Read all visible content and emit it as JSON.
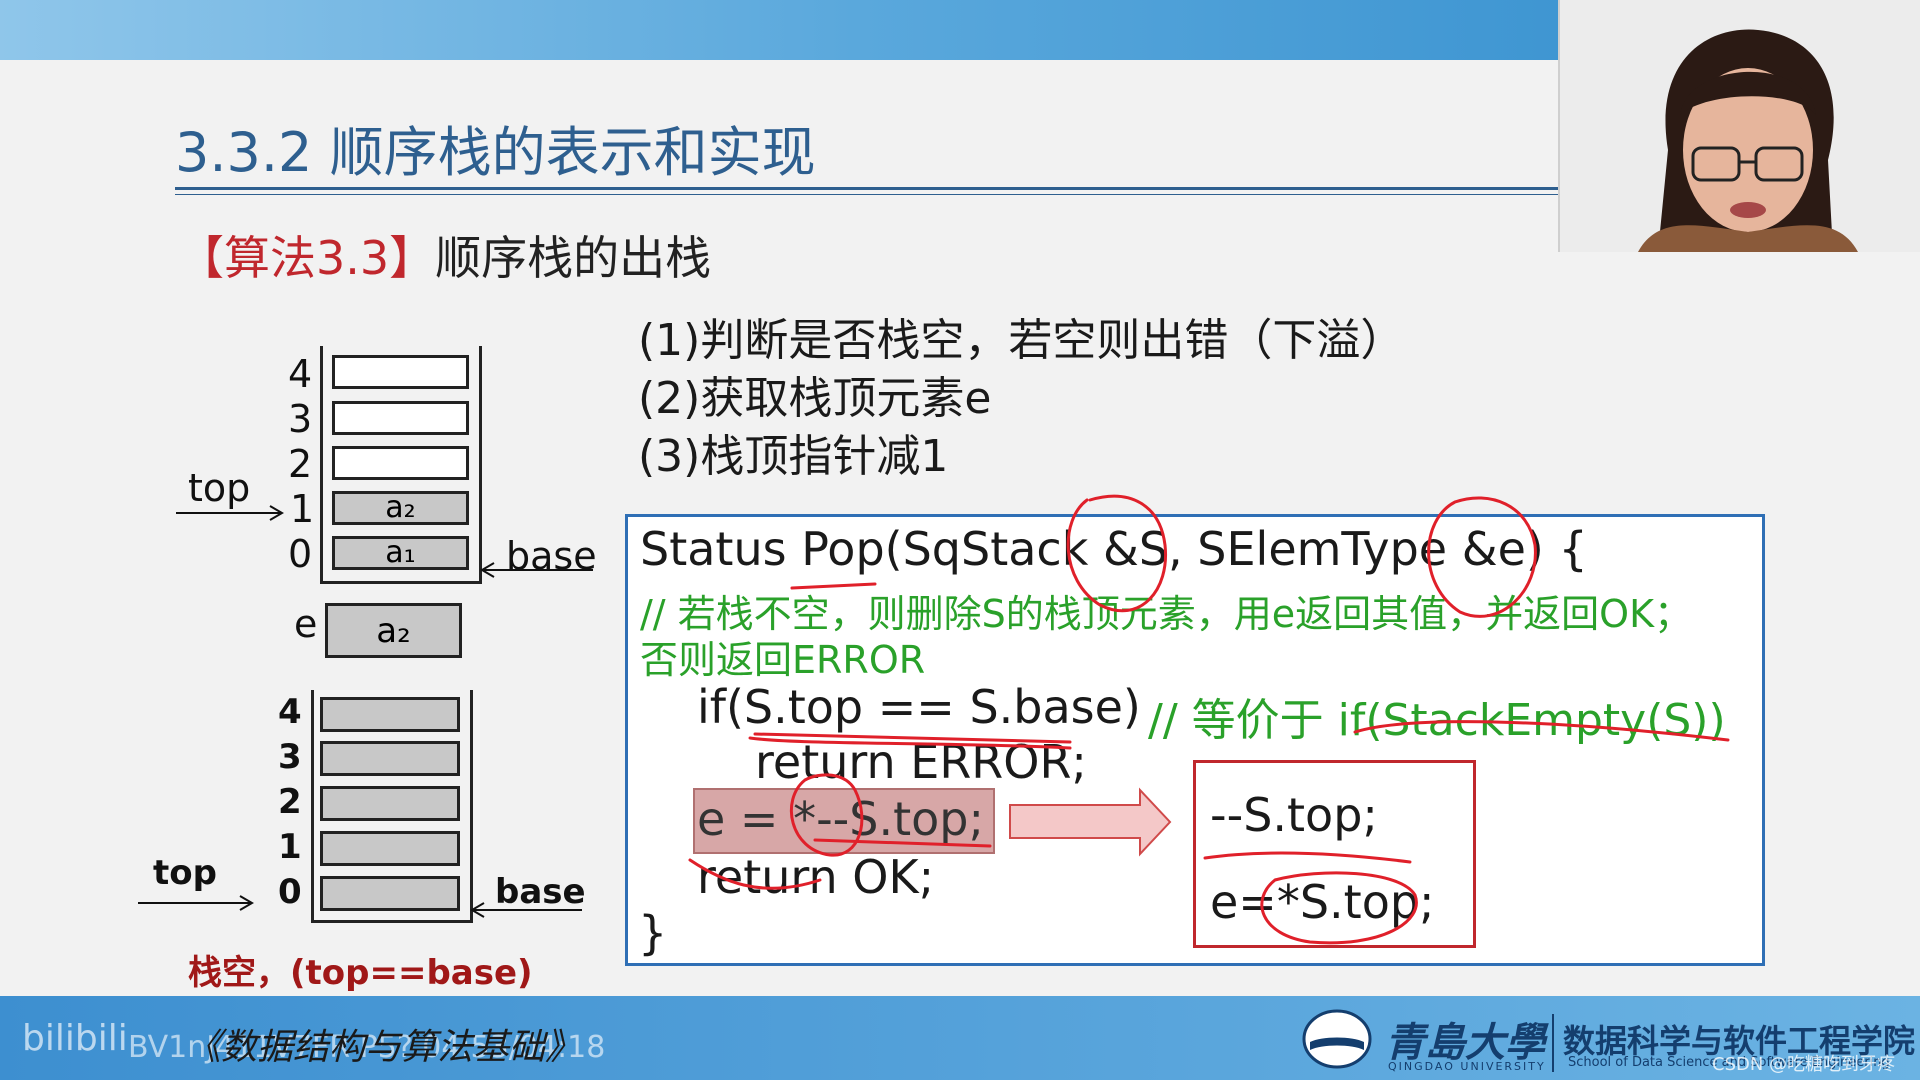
{
  "slide": {
    "title": "3.3.2 顺序栈的表示和实现",
    "algo_tag": "【算法3.3】",
    "algo_name": "顺序栈的出栈",
    "steps": [
      "(1)判断是否栈空，若空则出错（下溢）",
      "(2)获取栈顶元素e",
      "(3)栈顶指针减1"
    ],
    "code": {
      "line1": "Status Pop(SqStack &S, SElemType &e) {",
      "comment1": "// 若栈不空，则删除S的栈顶元素，用e返回其值，并返回OK；",
      "comment2": "否则返回ERROR",
      "line_if": "if(S.top == S.base)",
      "comment_if": "// 等价于 if(StackEmpty(S))",
      "line_return_error": "return ERROR;",
      "line_pop": "e = *--S.top;",
      "line_return_ok": "return OK;",
      "line_close": "}"
    },
    "equivalent": {
      "line1": "--S.top;",
      "line2": "e=*S.top;"
    },
    "diagram1": {
      "indices": [
        "4",
        "3",
        "2",
        "1",
        "0"
      ],
      "cells": [
        "",
        "",
        "",
        "a₂",
        "a₁"
      ],
      "top_label": "top",
      "base_label": "base",
      "e_label": "e",
      "e_value": "a₂"
    },
    "diagram2": {
      "indices": [
        "4",
        "3",
        "2",
        "1",
        "0"
      ],
      "top_label": "top",
      "base_label": "base",
      "caption": "栈空，(top==base)"
    }
  },
  "footer": {
    "book_title": "《数据结构与算法基础》",
    "watermark": "bilibili",
    "watermark_code": "BV1nJ411V7FR P5? 04:53/04:18",
    "university": "青島大學",
    "university_en": "QINGDAO UNIVERSITY",
    "school": "数据科学与软件工程学院",
    "school_en": "School of Data Science and Software Engineering",
    "csdn": "CSDN @吃糖吃到牙疼"
  },
  "colors": {
    "title_blue": "#2e5f8f",
    "accent_red": "#c0272d",
    "comment_green": "#2aa12a",
    "code_border": "#2f6fb5",
    "annotation_red": "#e0202a"
  }
}
